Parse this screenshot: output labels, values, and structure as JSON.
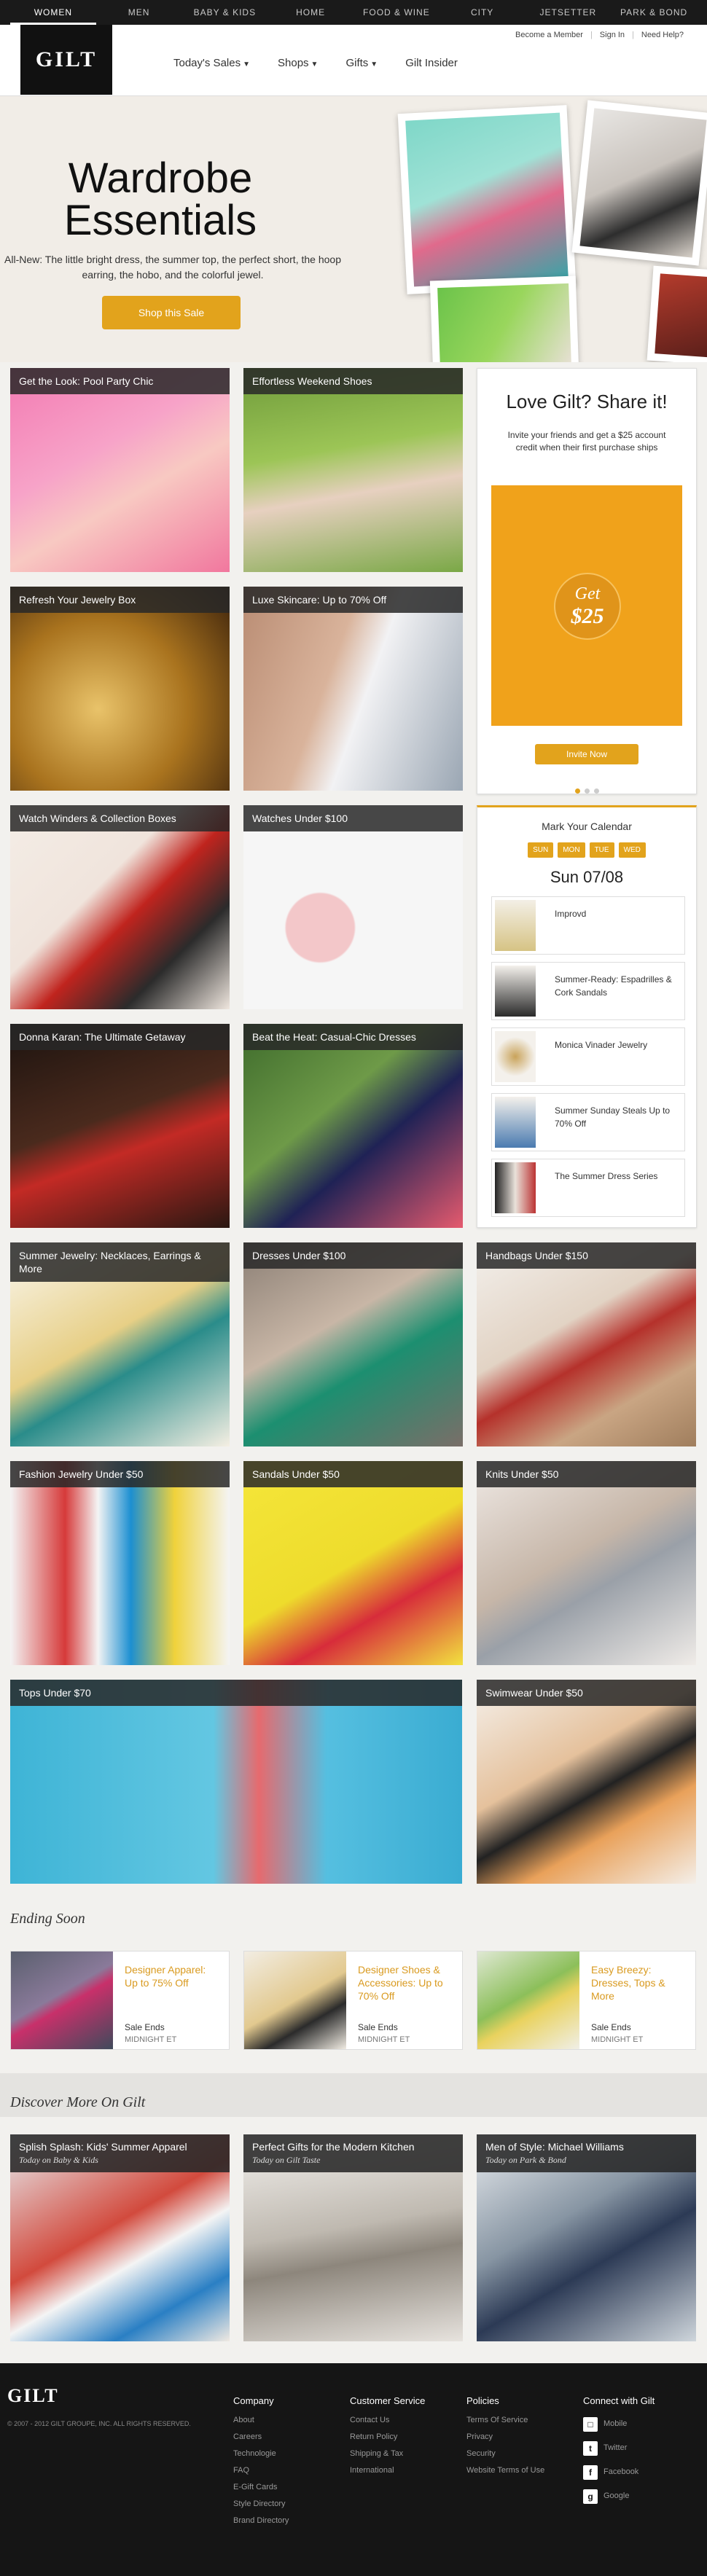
{
  "topnav": [
    "WOMEN",
    "MEN",
    "BABY & KIDS",
    "HOME",
    "FOOD & WINE",
    "CITY",
    "JETSETTER",
    "PARK & BOND"
  ],
  "header": {
    "logo": "GILT",
    "util": [
      "Become a Member",
      "Sign In",
      "Need Help?"
    ],
    "mainnav": [
      "Today's Sales",
      "Shops",
      "Gifts",
      "Gilt Insider"
    ]
  },
  "hero": {
    "title_line1": "Wardrobe",
    "title_line2": "Essentials",
    "desc": "All-New: The little bright dress, the summer top, the perfect short, the hoop earring, the hobo, and the colorful jewel.",
    "button": "Shop this Sale"
  },
  "tiles": [
    "Get the Look: Pool Party Chic",
    "Effortless Weekend Shoes",
    "Refresh Your Jewelry Box",
    "Luxe Skincare: Up to 70% Off",
    "Watch Winders & Collection Boxes",
    "Watches Under $100",
    "Donna Karan: The Ultimate Getaway",
    "Beat the Heat: Casual-Chic Dresses",
    "Summer Jewelry: Necklaces, Earrings & More",
    "Dresses Under $100",
    "Handbags Under $150",
    "Fashion Jewelry Under $50",
    "Sandals Under $50",
    "Knits Under $50",
    "Tops Under $70",
    "Swimwear Under $50"
  ],
  "share": {
    "title": "Love Gilt? Share it!",
    "desc": "Invite your friends and get a $25 account credit when their first purchase ships",
    "badge_line1": "Get",
    "badge_line2": "$25",
    "button": "Invite Now"
  },
  "calendar": {
    "title": "Mark Your Calendar",
    "days": [
      "SUN",
      "MON",
      "TUE",
      "WED"
    ],
    "date": "Sun 07/08",
    "events": [
      "Improvd",
      "Summer-Ready: Espadrilles & Cork Sandals",
      "Monica Vinader Jewelry",
      "Summer Sunday Steals Up to 70% Off",
      "The Summer Dress Series"
    ]
  },
  "ending": {
    "heading": "Ending Soon",
    "items": [
      {
        "title": "Designer Apparel: Up to 75% Off",
        "sale": "Sale Ends",
        "time": "MIDNIGHT ET"
      },
      {
        "title": "Designer Shoes & Accessories: Up to 70% Off",
        "sale": "Sale Ends",
        "time": "MIDNIGHT ET"
      },
      {
        "title": "Easy Breezy: Dresses, Tops & More",
        "sale": "Sale Ends",
        "time": "MIDNIGHT ET"
      }
    ]
  },
  "discover": {
    "heading": "Discover More On Gilt",
    "items": [
      {
        "title": "Splish Splash: Kids' Summer Apparel",
        "sub": "Today on Baby & Kids"
      },
      {
        "title": "Perfect Gifts for the Modern Kitchen",
        "sub": "Today on Gilt Taste"
      },
      {
        "title": "Men of Style: Michael Williams",
        "sub": "Today on Park & Bond"
      }
    ]
  },
  "footer": {
    "logo": "GILT",
    "copyright": "© 2007 - 2012 GILT GROUPE, INC. ALL RIGHTS RESERVED.",
    "company": {
      "h": "Company",
      "items": [
        "About",
        "Careers",
        "Technologie",
        "FAQ",
        "E-Gift Cards",
        "Style Directory",
        "Brand Directory"
      ]
    },
    "service": {
      "h": "Customer Service",
      "items": [
        "Contact Us",
        "Return Policy",
        "Shipping & Tax",
        "International"
      ]
    },
    "policies": {
      "h": "Policies",
      "items": [
        "Terms Of Service",
        "Privacy",
        "Security",
        "Website Terms of Use"
      ]
    },
    "connect": {
      "h": "Connect with Gilt",
      "items": [
        "Mobile",
        "Twitter",
        "Facebook",
        "Google"
      ]
    }
  },
  "colors": {
    "accent": "#e2a31c",
    "dark": "#1a1a1a"
  }
}
